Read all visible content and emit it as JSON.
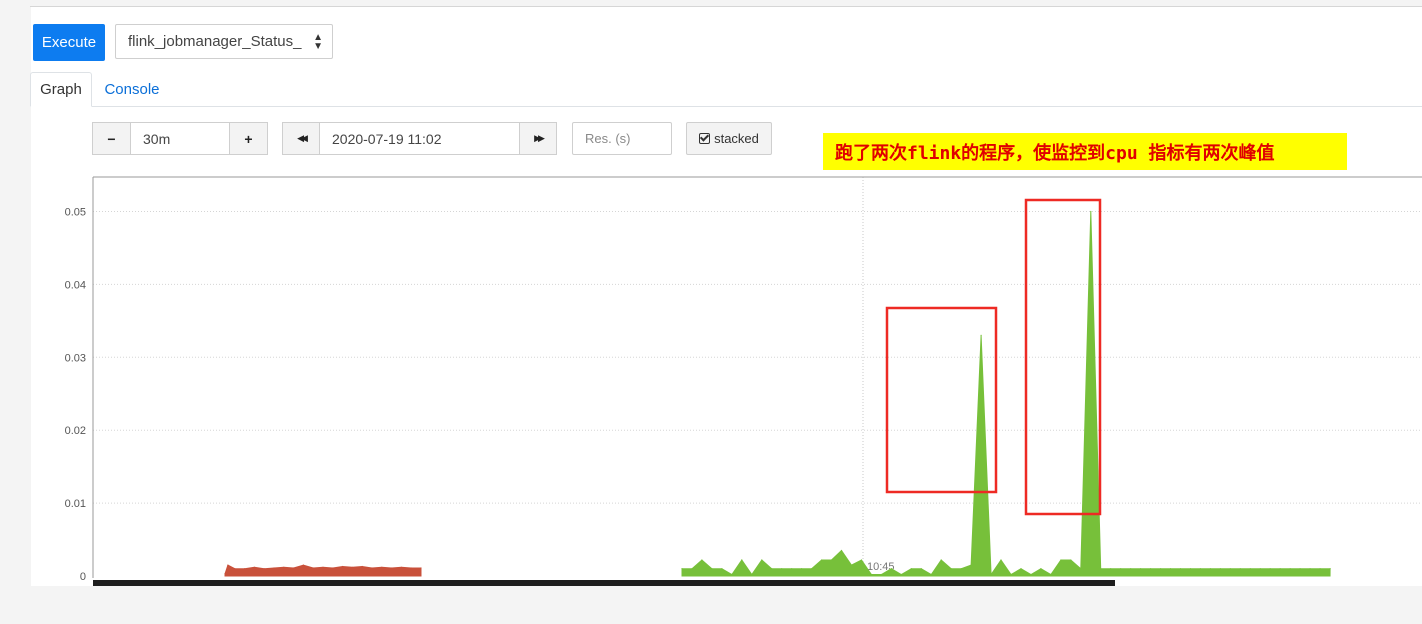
{
  "toolbar": {
    "execute_label": "Execute",
    "metric_selected": "flink_jobmanager_Status_"
  },
  "tabs": [
    {
      "label": "Graph",
      "active": true
    },
    {
      "label": "Console",
      "active": false
    }
  ],
  "graph_controls": {
    "range_decrease": "−",
    "range_value": "30m",
    "range_increase": "+",
    "end_back": "◀◀",
    "end_time": "2020-07-19 11:02",
    "end_forward": "▶▶",
    "resolution_placeholder": "Res. (s)",
    "stacked_label": "stacked",
    "stacked_checked": true
  },
  "annotation": {
    "text": "跑了两次flink的程序，使监控到cpu 指标有两次峰值",
    "background": "#ffff00",
    "color": "#e00000"
  },
  "colors": {
    "execute": "#0d7cf0",
    "series_red": "#c9513b",
    "series_green": "#77c03a",
    "highlight_box": "#ee2a24"
  },
  "chart_data": {
    "type": "area",
    "stacked": true,
    "ylim": [
      0,
      0.055
    ],
    "y_ticks": [
      "0",
      "0.01",
      "0.02",
      "0.03",
      "0.04",
      "0.05"
    ],
    "x_tick_labels": [
      "10:45"
    ],
    "grid": true,
    "series": [
      {
        "color": "#c9513b",
        "points": [
          [
            0,
            0.0003
          ],
          [
            0.3,
            0.0015
          ],
          [
            1,
            0.001
          ],
          [
            2,
            0.001
          ],
          [
            3,
            0.0012
          ],
          [
            4,
            0.001
          ],
          [
            5,
            0.0011
          ],
          [
            6,
            0.0012
          ],
          [
            7,
            0.0011
          ],
          [
            8,
            0.0015
          ],
          [
            9,
            0.0011
          ],
          [
            10,
            0.0012
          ],
          [
            11,
            0.0011
          ],
          [
            12,
            0.0013
          ],
          [
            13,
            0.0012
          ],
          [
            14,
            0.0013
          ],
          [
            15,
            0.0011
          ],
          [
            16,
            0.0012
          ],
          [
            17,
            0.0011
          ],
          [
            18,
            0.0012
          ],
          [
            19,
            0.0011
          ],
          [
            20,
            0.0011
          ]
        ]
      },
      {
        "color": "#77c03a",
        "points": [
          [
            0,
            0.001
          ],
          [
            1,
            0.001
          ],
          [
            2,
            0.0022
          ],
          [
            3,
            0.001
          ],
          [
            4,
            0.001
          ],
          [
            5,
            0.0002
          ],
          [
            6,
            0.0022
          ],
          [
            7,
            0.0002
          ],
          [
            8,
            0.0022
          ],
          [
            9,
            0.001
          ],
          [
            10,
            0.001
          ],
          [
            11,
            0.001
          ],
          [
            12,
            0.001
          ],
          [
            13,
            0.001
          ],
          [
            14,
            0.0022
          ],
          [
            15,
            0.0022
          ],
          [
            16,
            0.0035
          ],
          [
            17,
            0.0015
          ],
          [
            18,
            0.0022
          ],
          [
            19,
            0.0002
          ],
          [
            20,
            0.0002
          ],
          [
            21,
            0.001
          ],
          [
            22,
            0.0002
          ],
          [
            23,
            0.001
          ],
          [
            24,
            0.001
          ],
          [
            25,
            0.0002
          ],
          [
            26,
            0.0022
          ],
          [
            27,
            0.001
          ],
          [
            28,
            0.001
          ],
          [
            29,
            0.0015
          ],
          [
            30,
            0.033
          ],
          [
            31,
            0.0002
          ],
          [
            32,
            0.0022
          ],
          [
            33,
            0.0002
          ],
          [
            34,
            0.001
          ],
          [
            35,
            0.0002
          ],
          [
            36,
            0.001
          ],
          [
            37,
            0.0002
          ],
          [
            38,
            0.0022
          ],
          [
            39,
            0.0022
          ],
          [
            40,
            0.001
          ],
          [
            41,
            0.05
          ],
          [
            42,
            0.001
          ],
          [
            43,
            0.001
          ],
          [
            44,
            0.001
          ],
          [
            45,
            0.001
          ],
          [
            46,
            0.001
          ],
          [
            47,
            0.001
          ],
          [
            48,
            0.001
          ],
          [
            49,
            0.001
          ],
          [
            50,
            0.001
          ],
          [
            51,
            0.001
          ],
          [
            52,
            0.001
          ],
          [
            53,
            0.001
          ],
          [
            54,
            0.001
          ],
          [
            55,
            0.001
          ],
          [
            56,
            0.001
          ],
          [
            57,
            0.001
          ],
          [
            58,
            0.001
          ],
          [
            59,
            0.001
          ],
          [
            60,
            0.001
          ],
          [
            61,
            0.001
          ],
          [
            62,
            0.001
          ],
          [
            63,
            0.001
          ],
          [
            64,
            0.001
          ],
          [
            65,
            0.001
          ]
        ]
      }
    ],
    "highlighted_peaks": [
      {
        "peak_value": 0.033
      },
      {
        "peak_value": 0.05
      }
    ]
  }
}
